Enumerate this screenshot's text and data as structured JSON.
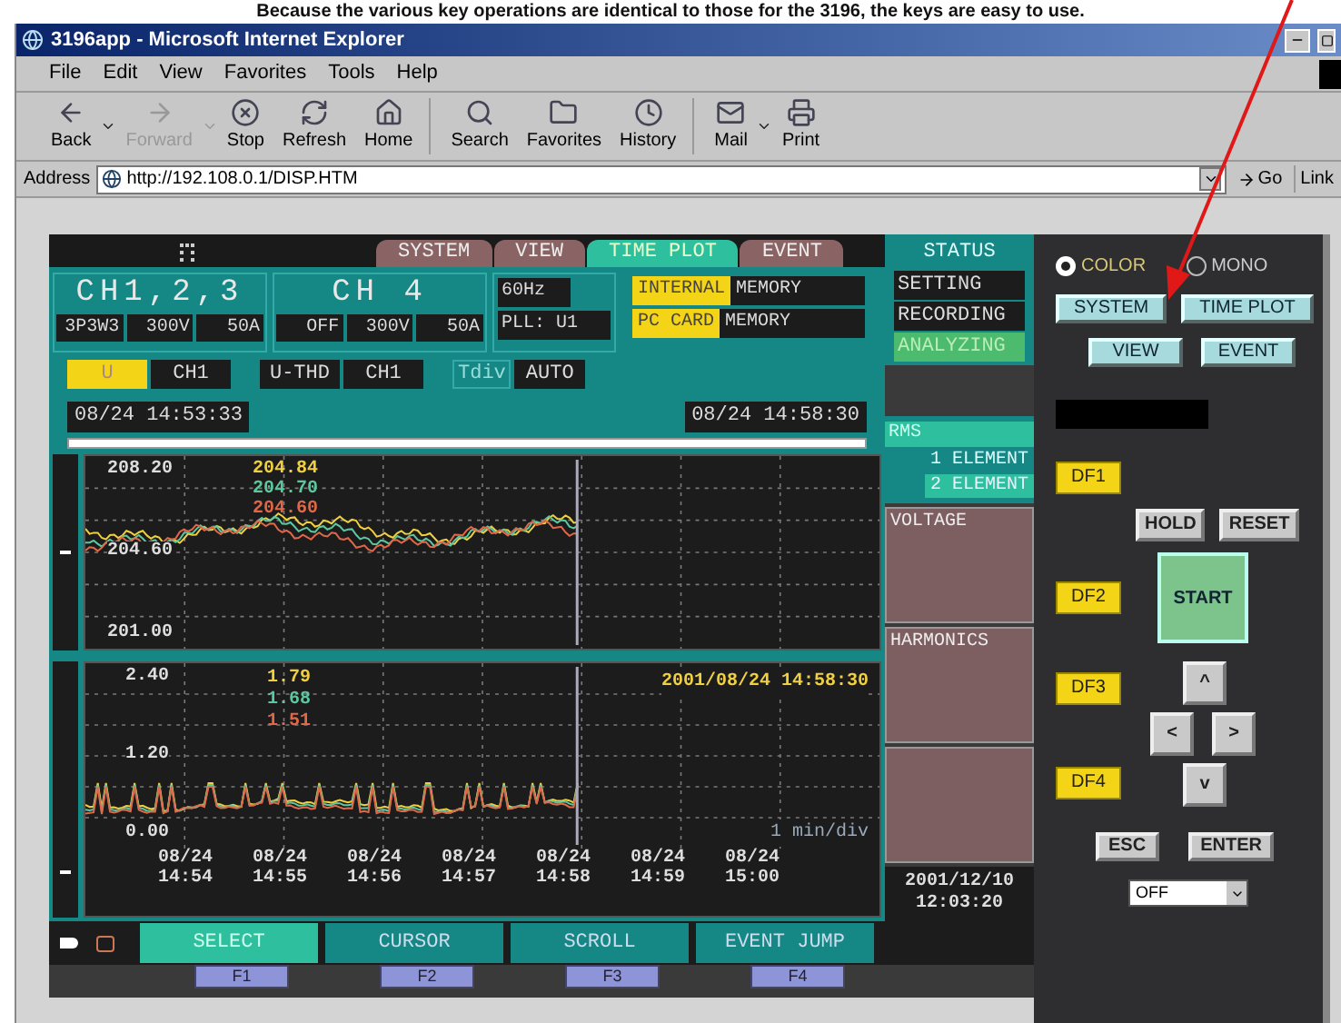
{
  "caption": "Because the various key operations are identical to those for the 3196, the keys are easy to use.",
  "window": {
    "title": "3196app - Microsoft Internet Explorer"
  },
  "menu": [
    "File",
    "Edit",
    "View",
    "Favorites",
    "Tools",
    "Help"
  ],
  "toolbar": [
    {
      "label": "Back",
      "kind": "back",
      "disabled": false,
      "dropdown": true
    },
    {
      "label": "Forward",
      "kind": "forward",
      "disabled": true,
      "dropdown": true
    },
    {
      "label": "Stop",
      "kind": "stop",
      "disabled": false,
      "dropdown": false
    },
    {
      "label": "Refresh",
      "kind": "refresh",
      "disabled": false,
      "dropdown": false
    },
    {
      "label": "Home",
      "kind": "home",
      "disabled": false,
      "dropdown": false
    },
    {
      "label": "Search",
      "kind": "search",
      "disabled": false,
      "dropdown": false
    },
    {
      "label": "Favorites",
      "kind": "favorites",
      "disabled": false,
      "dropdown": false
    },
    {
      "label": "History",
      "kind": "history",
      "disabled": false,
      "dropdown": false
    },
    {
      "label": "Mail",
      "kind": "mail",
      "disabled": false,
      "dropdown": true
    },
    {
      "label": "Print",
      "kind": "print",
      "disabled": false,
      "dropdown": false
    }
  ],
  "address": {
    "label": "Address",
    "url": "http://192.108.0.1/DISP.HTM",
    "go": "Go",
    "links": "Link"
  },
  "device": {
    "tabs": [
      {
        "label": "SYSTEM",
        "selected": false
      },
      {
        "label": "VIEW",
        "selected": false
      },
      {
        "label": "TIME PLOT",
        "selected": true
      },
      {
        "label": "EVENT",
        "selected": false
      }
    ],
    "channels": [
      {
        "title": "CH1,2,3",
        "cells": [
          "3P3W3",
          "300V",
          "50A"
        ]
      },
      {
        "title": "CH 4",
        "cells": [
          "OFF",
          "300V",
          "50A"
        ]
      }
    ],
    "frequency": "60Hz",
    "pll": "PLL: U1",
    "memory": [
      {
        "label": "INTERNAL",
        "suffix": "MEMORY"
      },
      {
        "label": "PC CARD",
        "suffix": "MEMORY"
      }
    ],
    "selectors": [
      {
        "label": "U",
        "selected": true
      },
      {
        "label": "CH1",
        "selected": false
      },
      {
        "label": "U-THD",
        "selected": false
      },
      {
        "label": "CH1",
        "selected": false
      }
    ],
    "tdiv": {
      "label": "Tdiv",
      "value": "AUTO"
    },
    "time_start": "08/24 14:53:33",
    "time_end": "08/24 14:58:30",
    "plot_voltage": {
      "y_labels": [
        "208.20",
        "204.60",
        "201.00"
      ],
      "readings": [
        {
          "value": "204.84",
          "color": "#f0d040"
        },
        {
          "value": "204.70",
          "color": "#5cc8a0"
        },
        {
          "value": "204.60",
          "color": "#e06848"
        }
      ]
    },
    "plot_harmonics": {
      "y_labels": [
        "2.40",
        "1.20",
        "0.00"
      ],
      "readings": [
        {
          "value": "1.79",
          "color": "#f0d040"
        },
        {
          "value": "1.68",
          "color": "#5cc8a0"
        },
        {
          "value": "1.51",
          "color": "#e06848"
        }
      ],
      "timestamp": "2001/08/24 14:58:30",
      "div_label": "1 min/div",
      "x_labels": [
        {
          "date": "08/24",
          "time": "14:54"
        },
        {
          "date": "08/24",
          "time": "14:55"
        },
        {
          "date": "08/24",
          "time": "14:56"
        },
        {
          "date": "08/24",
          "time": "14:57"
        },
        {
          "date": "08/24",
          "time": "14:58"
        },
        {
          "date": "08/24",
          "time": "14:59"
        },
        {
          "date": "08/24",
          "time": "15:00"
        }
      ]
    },
    "function_keys": [
      {
        "label": "SELECT",
        "key": "F1",
        "selected": true
      },
      {
        "label": "CURSOR",
        "key": "F2",
        "selected": false
      },
      {
        "label": "SCROLL",
        "key": "F3",
        "selected": false
      },
      {
        "label": "EVENT JUMP",
        "key": "F4",
        "selected": false
      }
    ]
  },
  "status": {
    "title": "STATUS",
    "items": [
      {
        "label": "SETTING",
        "selected": false
      },
      {
        "label": "RECORDING",
        "selected": false
      },
      {
        "label": "ANALYZING",
        "selected": true
      }
    ]
  },
  "mode": {
    "title": "RMS",
    "items": [
      {
        "label": "1 ELEMENT",
        "selected": false
      },
      {
        "label": "2 ELEMENT",
        "selected": true
      }
    ]
  },
  "panels": [
    "VOLTAGE",
    "HARMONICS"
  ],
  "clock": {
    "date": "2001/12/10",
    "time": "12:03:20"
  },
  "controls": {
    "display_modes": [
      {
        "label": "COLOR",
        "selected": true
      },
      {
        "label": "MONO",
        "selected": false
      }
    ],
    "screen_buttons": [
      "SYSTEM",
      "TIME PLOT",
      "VIEW",
      "EVENT"
    ],
    "df": [
      "DF1",
      "DF2",
      "DF3",
      "DF4"
    ],
    "hold": "HOLD",
    "reset": "RESET",
    "start": "START",
    "arrows": {
      "up": "^",
      "left": "<",
      "right": ">",
      "down": "v"
    },
    "esc": "ESC",
    "enter": "ENTER",
    "dropdown": "OFF"
  }
}
